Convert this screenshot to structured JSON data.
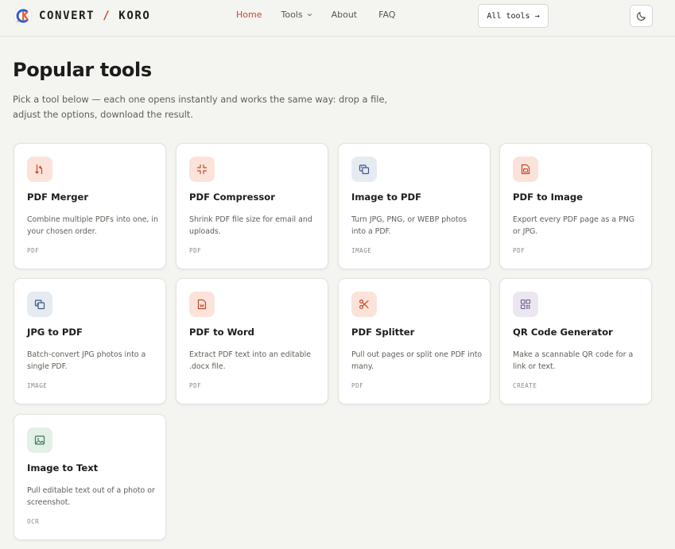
{
  "brand": {
    "name_part1": "CONVERT",
    "separator": "/",
    "name_part2": "KORO",
    "accent_color": "#c24a2a"
  },
  "nav": {
    "items": [
      {
        "label": "Home",
        "active": true
      },
      {
        "label": "Tools",
        "has_dropdown": true
      },
      {
        "label": "About"
      },
      {
        "label": "FAQ"
      }
    ],
    "all_tools_label": "All tools →",
    "theme_toggle_icon": "moon-icon"
  },
  "main": {
    "title": "Popular tools",
    "subtitle": "Pick a tool below — each one opens instantly and works the same way: drop a file, adjust the options, download the result."
  },
  "tools": [
    {
      "title": "PDF Merger",
      "desc": "Combine multiple PDFs into one, in your chosen order.",
      "tag": "PDF",
      "icon": "merge-icon",
      "tone": "pdf"
    },
    {
      "title": "PDF Compressor",
      "desc": "Shrink PDF file size for email and uploads.",
      "tag": "PDF",
      "icon": "compress-icon",
      "tone": "pdf"
    },
    {
      "title": "Image to PDF",
      "desc": "Turn JPG, PNG, or WEBP photos into a PDF.",
      "tag": "IMAGE",
      "icon": "image-to-pdf-icon",
      "tone": "image"
    },
    {
      "title": "PDF to Image",
      "desc": "Export every PDF page as a PNG or JPG.",
      "tag": "PDF",
      "icon": "pdf-to-image-icon",
      "tone": "pdf"
    },
    {
      "title": "JPG to PDF",
      "desc": "Batch-convert JPG photos into a single PDF.",
      "tag": "IMAGE",
      "icon": "jpg-to-pdf-icon",
      "tone": "image"
    },
    {
      "title": "PDF to Word",
      "desc": "Extract PDF text into an editable .docx file.",
      "tag": "PDF",
      "icon": "pdf-to-word-icon",
      "tone": "pdf"
    },
    {
      "title": "PDF Splitter",
      "desc": "Pull out pages or split one PDF into many.",
      "tag": "PDF",
      "icon": "scissors-icon",
      "tone": "pdf"
    },
    {
      "title": "QR Code Generator",
      "desc": "Make a scannable QR code for a link or text.",
      "tag": "CREATE",
      "icon": "qr-code-icon",
      "tone": "create"
    },
    {
      "title": "Image to Text",
      "desc": "Pull editable text out of a photo or screenshot.",
      "tag": "OCR",
      "icon": "image-icon",
      "tone": "ocr"
    }
  ],
  "colors": {
    "pdf_icon": "#c24a2a",
    "image_icon": "#3c5a86",
    "create_icon": "#6a5a86",
    "ocr_icon": "#3d7a56",
    "background": "#f4f4f1"
  }
}
